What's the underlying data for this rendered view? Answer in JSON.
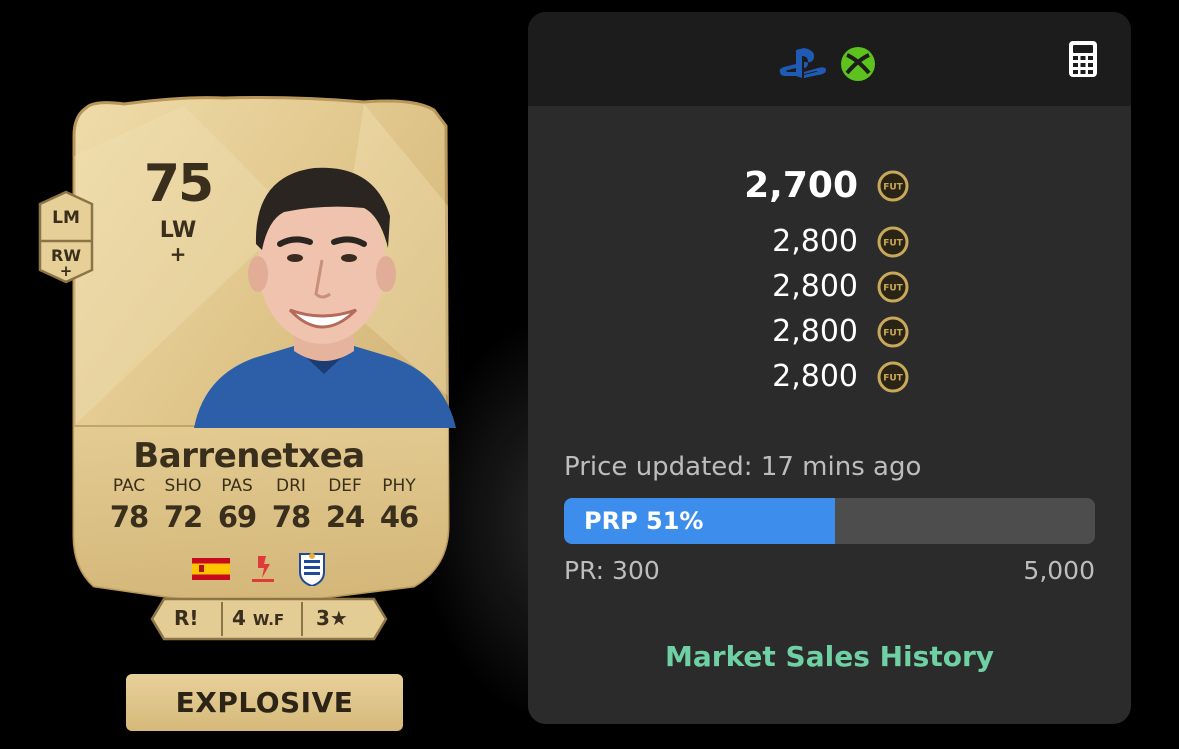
{
  "card": {
    "rating": "75",
    "position": "LW",
    "position_plus": "+",
    "alt_positions": [
      "LM",
      "RW"
    ],
    "alt_position_plus": "+",
    "name": "Barrenetxea",
    "stats": [
      {
        "label": "PAC",
        "value": "78"
      },
      {
        "label": "SHO",
        "value": "72"
      },
      {
        "label": "PAS",
        "value": "69"
      },
      {
        "label": "DRI",
        "value": "78"
      },
      {
        "label": "DEF",
        "value": "24"
      },
      {
        "label": "PHY",
        "value": "46"
      }
    ],
    "skill_label": "R",
    "weak_foot": "4",
    "weak_foot_suffix": "W.F",
    "skill_moves": "3",
    "nation_icon": "spain-flag-icon",
    "league_icon": "laliga-logo-icon",
    "club_icon": "real-sociedad-crest-icon"
  },
  "playstyle": "EXPLOSIVE",
  "panel": {
    "platform_icons": [
      "playstation-icon",
      "xbox-icon"
    ],
    "calculator_icon": "calculator-icon",
    "prices": [
      "2,700",
      "2,800",
      "2,800",
      "2,800",
      "2,800"
    ],
    "coin_label": "FUT",
    "updated": "Price updated: 17 mins ago",
    "prp_label": "PRP 51%",
    "prp_fraction": 0.51,
    "pr_min": "PR: 300",
    "pr_max": "5,000",
    "market_link": "Market Sales History"
  },
  "colors": {
    "card_gold": "#e2c88d",
    "prp_blue": "#3d8eec",
    "link_green": "#6fd0a4",
    "panel_bg": "#2b2b2b",
    "header_bg": "#1c1c1c"
  }
}
